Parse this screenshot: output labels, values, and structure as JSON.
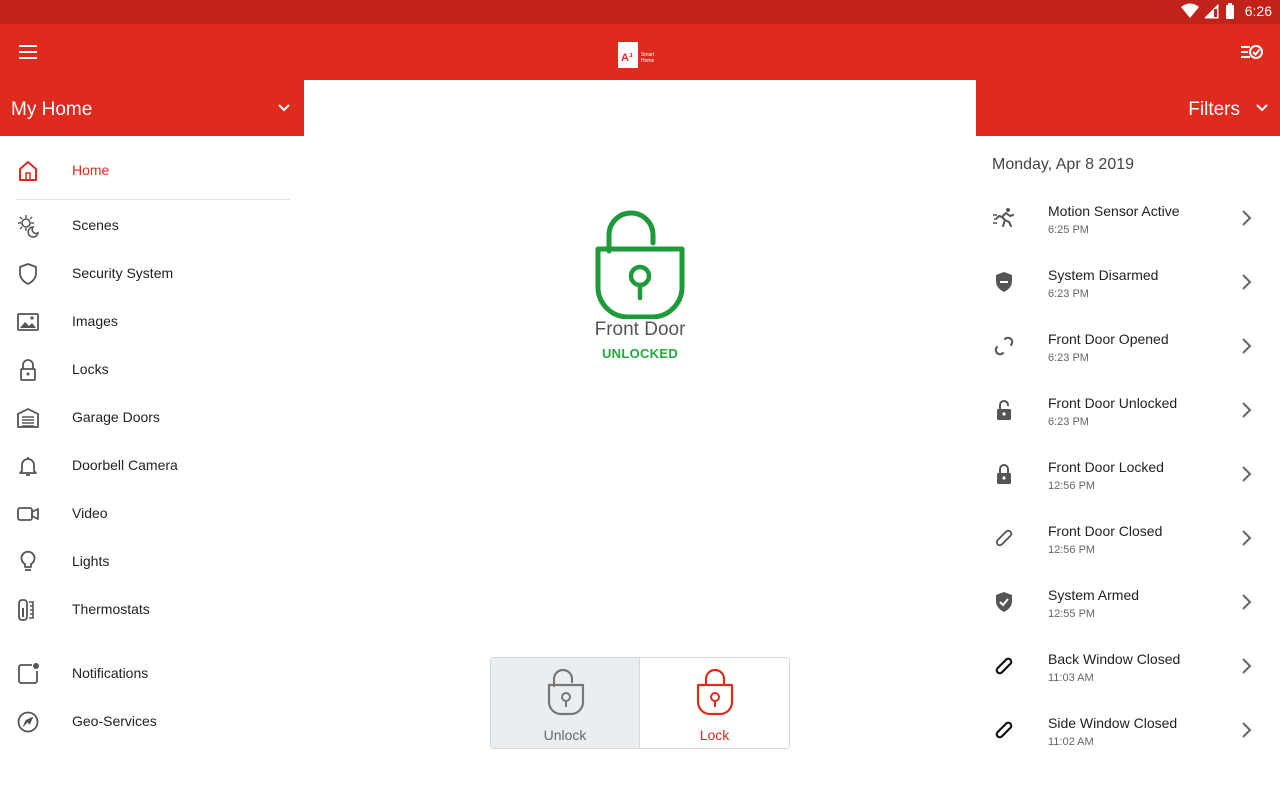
{
  "status_bar": {
    "time": "6:26"
  },
  "app_bar": {
    "logo_text": "A³",
    "logo_subtext": "Smart Home"
  },
  "home_selector": {
    "label": "My Home"
  },
  "filters": {
    "label": "Filters"
  },
  "sidebar": {
    "items": [
      {
        "label": "Home",
        "icon": "home-icon",
        "active": true
      },
      {
        "label": "Scenes",
        "icon": "scenes-icon"
      },
      {
        "label": "Security System",
        "icon": "shield-icon"
      },
      {
        "label": "Images",
        "icon": "image-icon"
      },
      {
        "label": "Locks",
        "icon": "lock-icon"
      },
      {
        "label": "Garage Doors",
        "icon": "garage-icon"
      },
      {
        "label": "Doorbell Camera",
        "icon": "bell-icon"
      },
      {
        "label": "Video",
        "icon": "video-icon"
      },
      {
        "label": "Lights",
        "icon": "bulb-icon"
      },
      {
        "label": "Thermostats",
        "icon": "thermostat-icon"
      },
      {
        "label": "Notifications",
        "icon": "notification-icon"
      },
      {
        "label": "Geo-Services",
        "icon": "navigation-icon"
      }
    ]
  },
  "device": {
    "name": "Front Door",
    "state": "UNLOCKED",
    "state_color": "#1eaa3a",
    "actions": {
      "unlock_label": "Unlock",
      "lock_label": "Lock"
    }
  },
  "activity": {
    "date": "Monday, Apr 8 2019",
    "events": [
      {
        "title": "Motion Sensor Active",
        "time": "6:25 PM",
        "icon": "motion-icon"
      },
      {
        "title": "System Disarmed",
        "time": "6:23 PM",
        "icon": "shield-disarmed-icon"
      },
      {
        "title": "Front Door Opened",
        "time": "6:23 PM",
        "icon": "link-open-icon"
      },
      {
        "title": "Front Door Unlocked",
        "time": "6:23 PM",
        "icon": "unlocked-icon"
      },
      {
        "title": "Front Door Locked",
        "time": "12:56 PM",
        "icon": "locked-icon"
      },
      {
        "title": "Front Door Closed",
        "time": "12:56 PM",
        "icon": "link-closed-icon"
      },
      {
        "title": "System Armed",
        "time": "12:55 PM",
        "icon": "shield-armed-icon"
      },
      {
        "title": "Back Window Closed",
        "time": "11:03 AM",
        "icon": "link-closed-icon"
      },
      {
        "title": "Side Window Closed",
        "time": "11:02 AM",
        "icon": "link-closed-icon"
      }
    ]
  },
  "colors": {
    "brand": "#df2a1e",
    "status_bar": "#c1221a",
    "unlocked": "#1eaa3a"
  }
}
